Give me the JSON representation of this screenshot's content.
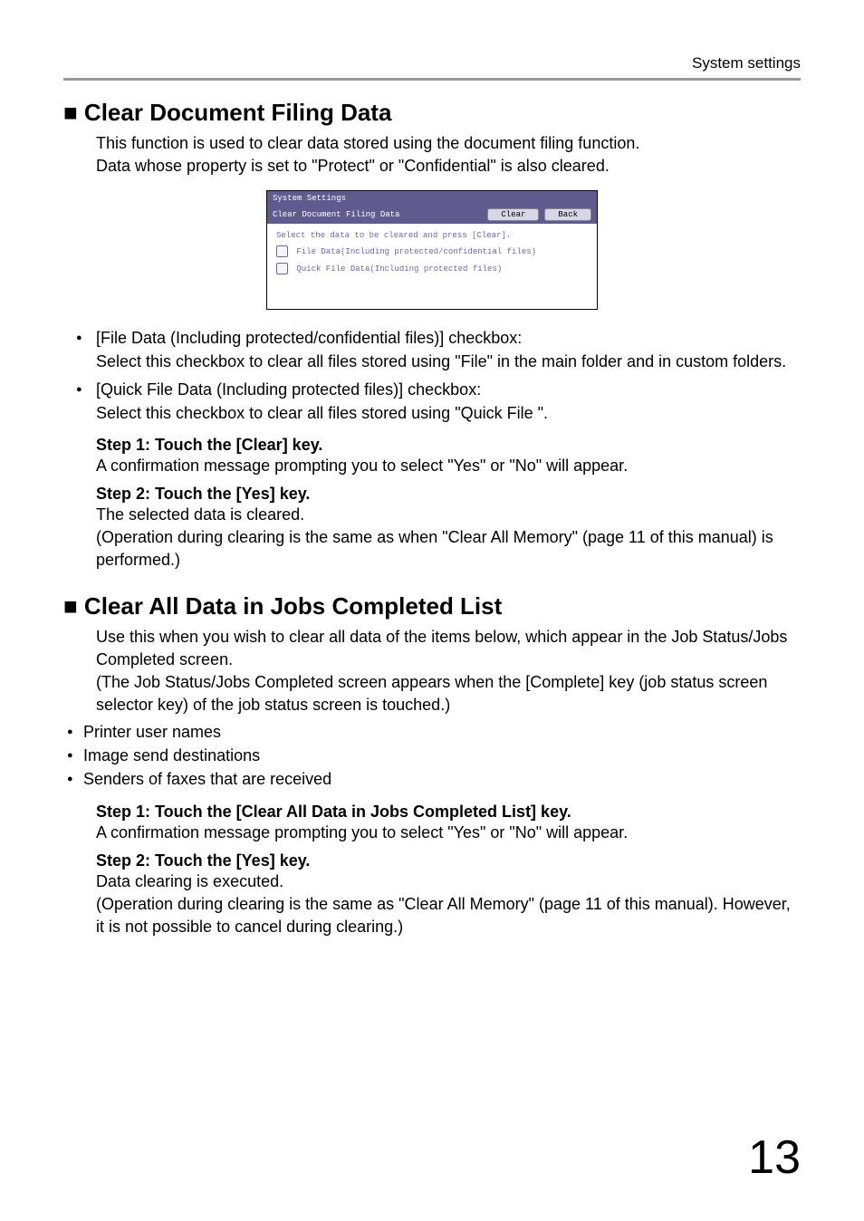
{
  "header": {
    "right": "System settings"
  },
  "section1": {
    "title": "■ Clear Document Filing Data",
    "intro1": "This function is used to clear data stored using the document filing function.",
    "intro2": "Data whose property is set to \"Protect\" or \"Confidential\" is also cleared.",
    "screenshot": {
      "title": "System Settings",
      "bar_label": "Clear Document Filing Data",
      "btn_clear": "Clear",
      "btn_back": "Back",
      "instruction": "Select the data to be cleared and press [Clear].",
      "check1": "File Data(Including protected/confidential files)",
      "check2": "Quick File Data(Including protected files)"
    },
    "bullet1_title": "[File Data (Including protected/confidential files)] checkbox:",
    "bullet1_body": "Select this checkbox to clear all files stored using \"File\" in the main folder and in custom folders.",
    "bullet2_title": "[Quick File Data (Including protected files)] checkbox:",
    "bullet2_body": "Select this checkbox to clear all files stored using \"Quick File \".",
    "step1_title": "Step 1: Touch the [Clear] key.",
    "step1_body": "A confirmation message prompting you to select \"Yes\" or \"No\" will appear.",
    "step2_title": "Step 2: Touch the [Yes] key.",
    "step2_body1": "The selected data is cleared.",
    "step2_body2": "(Operation during clearing is the same as when \"Clear All Memory\" (page 11 of this manual) is performed.)"
  },
  "section2": {
    "title": "■ Clear All Data in Jobs Completed List",
    "intro1": "Use this when you wish to clear all data of the items below, which appear in the Job Status/Jobs Completed screen.",
    "intro2": " (The Job Status/Jobs Completed screen appears when the [Complete] key (job status screen selector key) of the job status screen is touched.)",
    "b1": "Printer user names",
    "b2": "Image send destinations",
    "b3": "Senders of faxes that are received",
    "step1_title": "Step 1: Touch the [Clear All Data in Jobs Completed List] key.",
    "step1_body": "A confirmation message prompting you to select \"Yes\" or \"No\" will appear.",
    "step2_title": "Step 2: Touch the [Yes] key.",
    "step2_body1": "Data clearing is executed.",
    "step2_body2": "(Operation during clearing is the same as \"Clear All Memory\" (page 11 of this manual). However, it is not possible to cancel during clearing.)"
  },
  "page_number": "13"
}
